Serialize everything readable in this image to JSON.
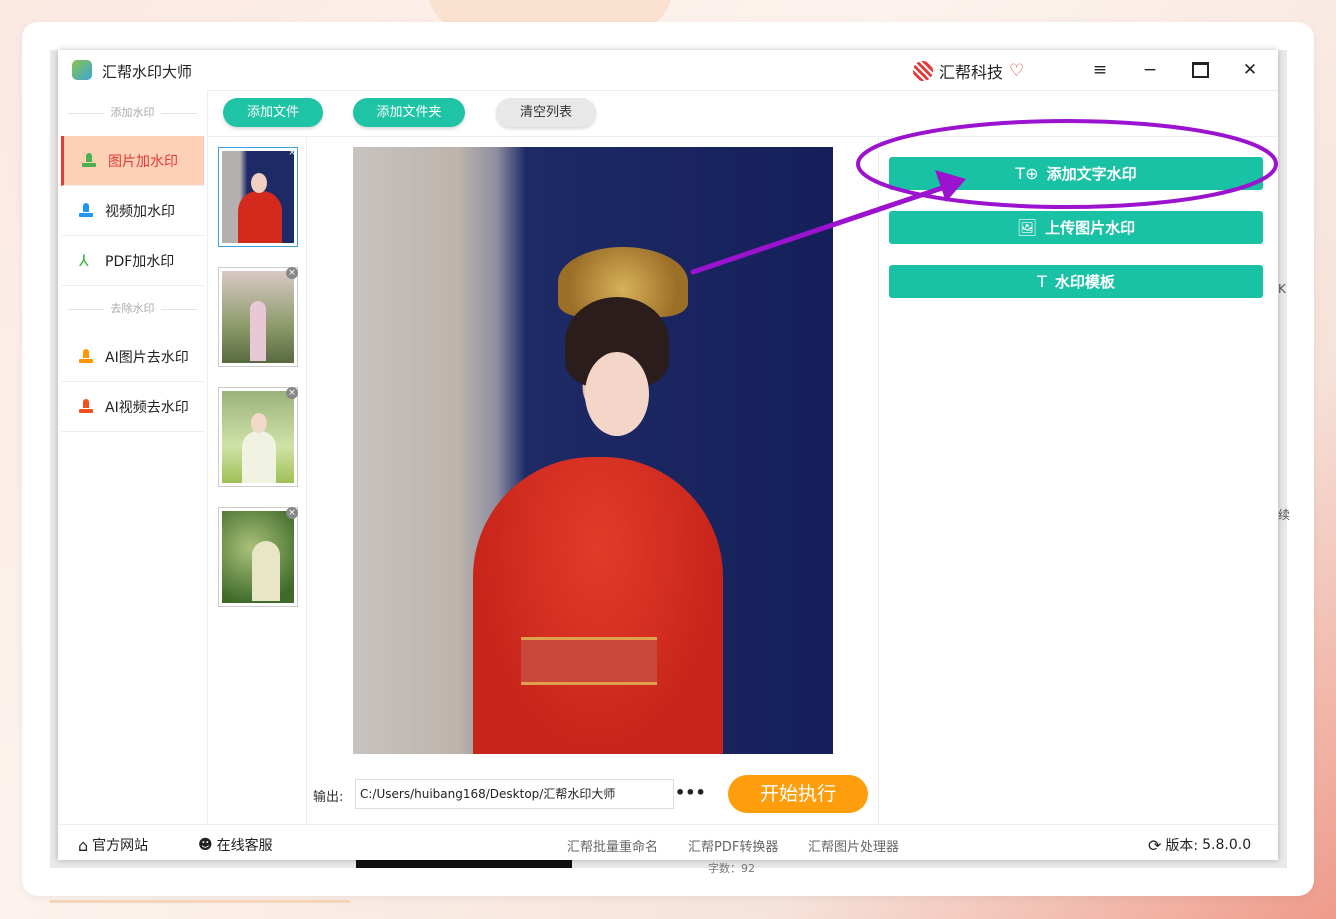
{
  "app": {
    "title": "汇帮水印大师",
    "brand": "汇帮科技",
    "window_controls": [
      "menu-icon",
      "minimize-icon",
      "maximize-icon",
      "close-icon"
    ]
  },
  "sidebar": {
    "add_section": "添加水印",
    "remove_section": "去除水印",
    "items": [
      {
        "label": "图片加水印",
        "icon": "stamp-icon",
        "active": true
      },
      {
        "label": "视频加水印",
        "icon": "stamp-icon"
      },
      {
        "label": "PDF加水印",
        "icon": "pdf-icon"
      },
      {
        "label": "AI图片去水印",
        "icon": "stamp-icon"
      },
      {
        "label": "AI视频去水印",
        "icon": "stamp-icon"
      }
    ]
  },
  "toolbar": {
    "add_file": "添加文件",
    "add_folder": "添加文件夹",
    "clear_list": "清空列表"
  },
  "output": {
    "label": "输出:",
    "path": "C:/Users/huibang168/Desktop/汇帮水印大师",
    "more": "•••",
    "start": "开始执行"
  },
  "right_panel": {
    "add_text_watermark": "添加文字水印",
    "upload_image_watermark": "上传图片水印",
    "watermark_template": "水印模板"
  },
  "bottom": {
    "website": "官方网站",
    "support": "在线客服",
    "links": [
      "汇帮批量重命名",
      "汇帮PDF转换器",
      "汇帮图片处理器"
    ],
    "version_label": "版本:",
    "version": "5.8.0.0"
  },
  "background": {
    "fragment_1": "K",
    "fragment_2": "续",
    "word_count": "字数：92"
  },
  "colors": {
    "accent": "#1ec4a5",
    "start": "#ff9e0d",
    "active_bg": "#fcd1b6",
    "active_text": "#e53935",
    "annotation": "#9b12cf"
  }
}
